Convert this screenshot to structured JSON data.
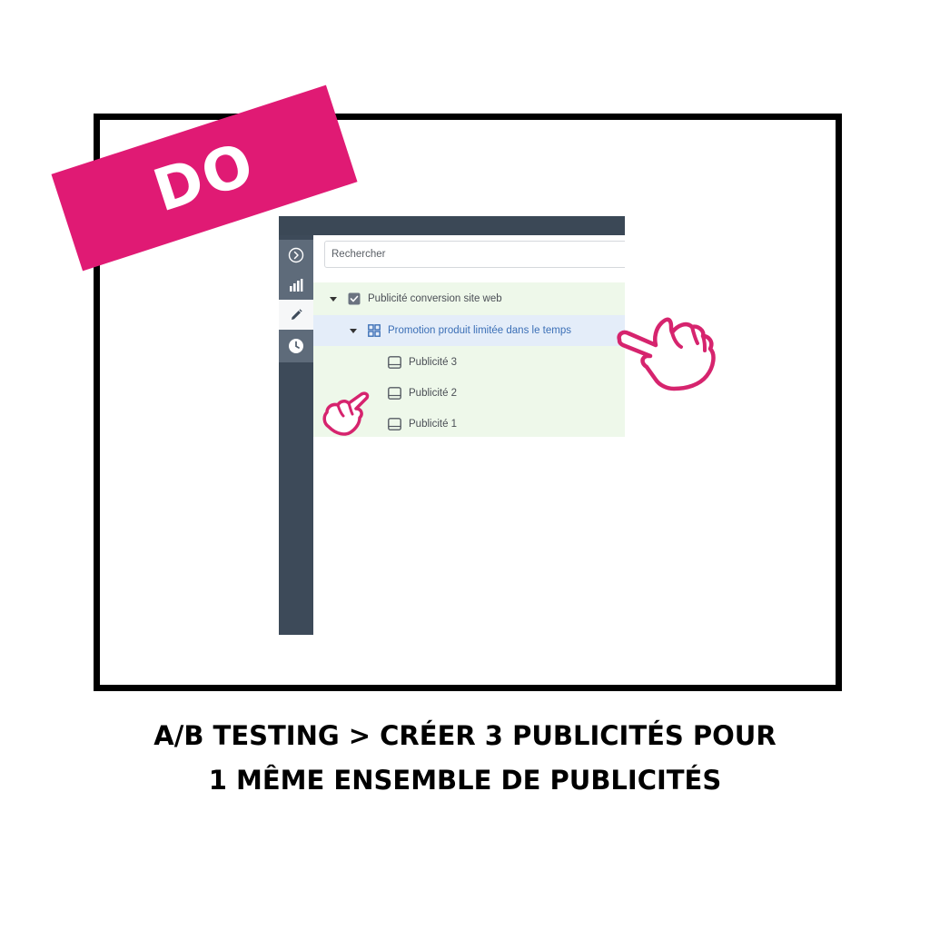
{
  "badge": {
    "text": "DO",
    "color": "#e01a74"
  },
  "screenshot": {
    "sidebar": {
      "items": [
        {
          "icon": "chevron-right-circle-icon"
        },
        {
          "icon": "bar-chart-icon"
        },
        {
          "icon": "pencil-icon",
          "active": true
        },
        {
          "icon": "clock-icon"
        }
      ]
    },
    "search": {
      "placeholder": "Rechercher",
      "value": ""
    },
    "tree": {
      "campaign": {
        "label": "Publicité conversion site web",
        "icon": "campaign-checkbox-icon"
      },
      "adset": {
        "label": "Promotion produit limitée dans le temps",
        "icon": "adset-grid-icon",
        "selected": true
      },
      "ads": [
        {
          "label": "Publicité 3",
          "icon": "ad-icon"
        },
        {
          "label": "Publicité 2",
          "icon": "ad-icon"
        },
        {
          "label": "Publicité 1",
          "icon": "ad-icon"
        }
      ]
    }
  },
  "annotations": {
    "hand_color": "#d6246e",
    "hands": [
      "pointing-hand-icon",
      "pointing-hand-icon"
    ]
  },
  "caption": {
    "line1": "A/B TESTING > CRÉER 3 PUBLICITÉS POUR",
    "line2": "1 MÊME ENSEMBLE DE PUBLICITÉS"
  }
}
